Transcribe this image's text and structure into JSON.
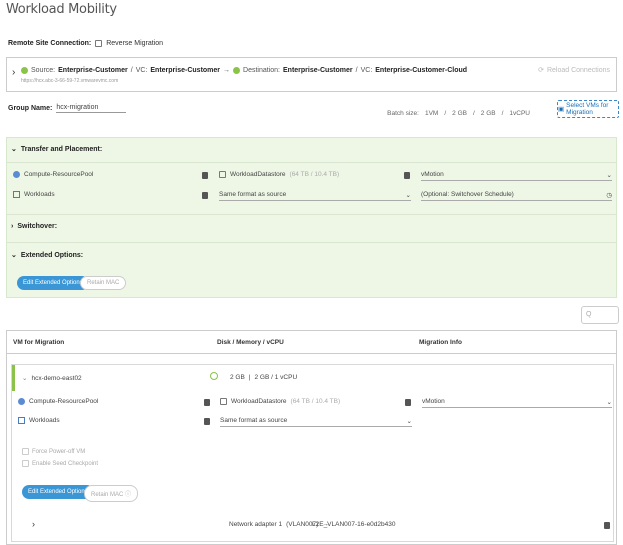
{
  "page": {
    "title": "Workload Mobility"
  },
  "remote": {
    "label": "Remote Site Connection:",
    "reverse": "Reverse Migration"
  },
  "site": {
    "source_label": "Source:",
    "source": "Enterprise-Customer",
    "sep": "/",
    "vc_label": "VC:",
    "source_vc": "Enterprise-Customer",
    "arrow": "→",
    "dest_label": "Destination:",
    "dest": "Enterprise-Customer",
    "dest_vc": "Enterprise-Customer-Cloud",
    "url": "https://hcx.abc-3-66-59-72.vmwarevmc.com",
    "reload": "Reload Connections"
  },
  "group": {
    "label": "Group Name:",
    "value": "hcx-migration"
  },
  "batch": {
    "label": "Batch size:",
    "vms": "1VM",
    "mem1": "2 GB",
    "mem2": "2 GB",
    "cpu": "1vCPU",
    "slash": "/"
  },
  "select_btn": "Select VMs for Migration",
  "transfer": {
    "title": "Transfer and Placement:",
    "compute": "Compute-ResourcePool",
    "datastore": "WorkloadDatastore",
    "ds_size": "(64 TB / 10.4 TB)",
    "migration": "vMotion",
    "folder": "Workloads",
    "format": "Same format as source",
    "schedule": "(Optional: Switchover Schedule)"
  },
  "switchover": {
    "title": "Switchover:"
  },
  "extended": {
    "title": "Extended Options:",
    "edit": "Edit Extended Options",
    "retain": "Retain MAC"
  },
  "search": {
    "placeholder": "Q"
  },
  "table": {
    "col1": "VM for Migration",
    "col2": "Disk / Memory / vCPU",
    "col3": "Migration Info",
    "vm": {
      "name": "hcx-demo-east02",
      "disk": "2 GB",
      "memcpu": "2 GB / 1 vCPU",
      "compute": "Compute-ResourcePool",
      "datastore": "WorkloadDatastore",
      "ds_size": "(64 TB / 10.4 TB)",
      "migration": "vMotion",
      "folder": "Workloads",
      "format": "Same format as source",
      "force": "Force Power-off VM",
      "seed": "Enable Seed Checkpoint",
      "edit": "Edit Extended Options",
      "retain": "Retain MAC",
      "network_label": "Network adapter 1",
      "network_src": "(VLAN007)",
      "network_dst": "L2E_VLAN007-16-e0d2b430"
    }
  },
  "colors": {
    "accent": "#3b96d6",
    "green_panel": "#eef7e6",
    "status_green": "#8bc34a"
  }
}
